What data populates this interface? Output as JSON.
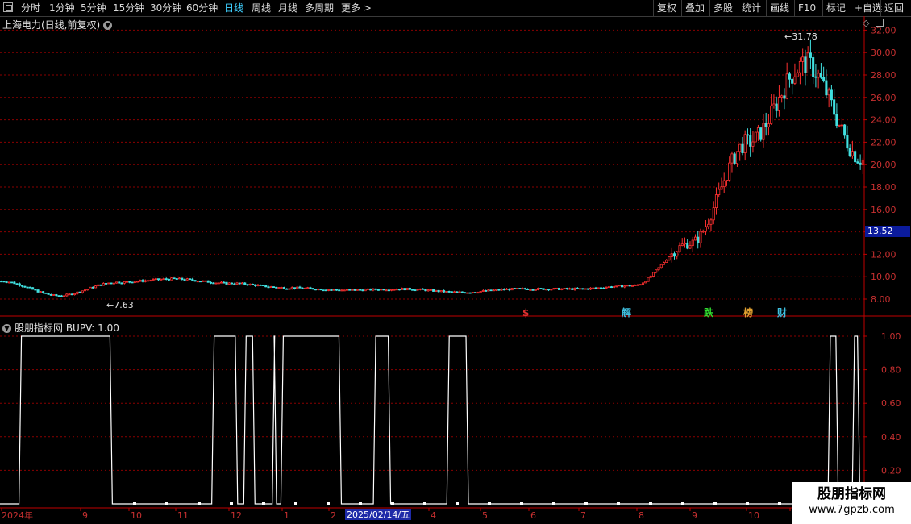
{
  "toolbar": {
    "periods": [
      {
        "label": "分时",
        "active": false
      },
      {
        "label": "1分钟",
        "active": false
      },
      {
        "label": "5分钟",
        "active": false
      },
      {
        "label": "15分钟",
        "active": false
      },
      {
        "label": "30分钟",
        "active": false
      },
      {
        "label": "60分钟",
        "active": false
      },
      {
        "label": "日线",
        "active": true
      },
      {
        "label": "周线",
        "active": false
      },
      {
        "label": "月线",
        "active": false
      },
      {
        "label": "多周期",
        "active": false
      },
      {
        "label": "更多 >",
        "active": false
      }
    ],
    "right_buttons": [
      "复权",
      "叠加",
      "多股",
      "统计",
      "画线",
      "F10",
      "标记",
      "+自选",
      "返回"
    ]
  },
  "chart": {
    "stock_title": "上海电力(日线,前复权)",
    "current_price": "13.52",
    "low_label": "←7.63",
    "high_label": "←31.78",
    "price_axis_labels": [
      "32.00",
      "30.00",
      "28.00",
      "26.00",
      "24.00",
      "22.00",
      "20.00",
      "18.00",
      "16.00",
      "14.00",
      "12.00",
      "10.00",
      "8.00"
    ],
    "badges": [
      {
        "label": "$",
        "color": "#e03030"
      },
      {
        "label": "解",
        "color": "#3fc0e0"
      },
      {
        "label": "跌",
        "color": "#30e030"
      },
      {
        "label": "榜",
        "color": "#e0a030"
      },
      {
        "label": "财",
        "color": "#3fc0e0"
      }
    ],
    "colors": {
      "up": "#ff3030",
      "down": "#40e0e0",
      "grid": "#8a0000",
      "axis": "#c00000",
      "indicator": "#ffffff"
    }
  },
  "indicator": {
    "title": "股朋指标网  BUPV: 1.00",
    "axis_labels": [
      "1.00",
      "0.80",
      "0.60",
      "0.40",
      "0.20"
    ]
  },
  "time_axis": {
    "labels": [
      "2024年",
      "9",
      "10",
      "11",
      "12",
      "1",
      "2",
      "4",
      "5",
      "6",
      "7",
      "8",
      "9",
      "10",
      "1"
    ],
    "selected_date": "2025/02/14/五"
  },
  "watermark": {
    "line1": "股朋指标网",
    "line2": "www.7gpzb.com"
  },
  "chart_data": {
    "type": "candlestick",
    "title": "上海电力(日线,前复权)",
    "ylim": [
      7,
      33
    ],
    "x": [
      "2024-08",
      "2024-09",
      "2024-10",
      "2024-11",
      "2024-12",
      "2025-01",
      "2025-02",
      "2025-03",
      "2025-04",
      "2025-05",
      "2025-06",
      "2025-07",
      "2025-08",
      "2025-09",
      "2025-10",
      "2025-11"
    ],
    "close_approx": [
      9.6,
      8.3,
      9.5,
      9.8,
      9.4,
      9.0,
      8.8,
      8.9,
      8.6,
      8.9,
      8.9,
      9.2,
      13.0,
      22.0,
      29.0,
      20.4
    ],
    "annotations": {
      "low": 7.63,
      "high": 31.78,
      "current": 13.52
    },
    "indicator": {
      "name": "BUPV",
      "value": 1.0,
      "ylim": [
        0,
        1
      ],
      "high_periods_approx": [
        "2024-07 to 2024-09",
        "2024-12",
        "2025-01 to 2025-02",
        "2025-03",
        "2025-04 to 2025-05",
        "2025-11"
      ]
    }
  }
}
